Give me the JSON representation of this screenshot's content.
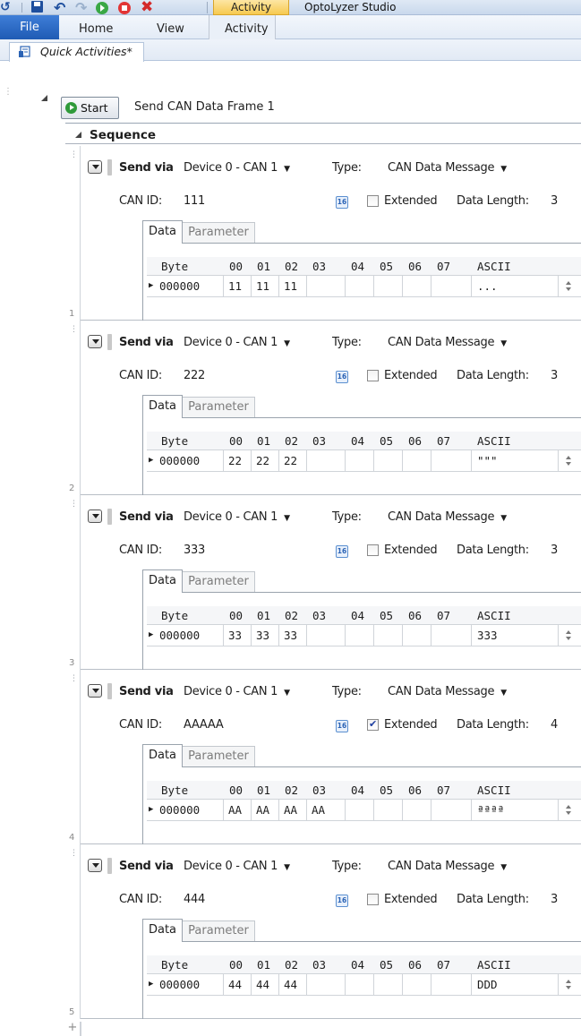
{
  "titlebar": {
    "context_tab": "Activity",
    "app_title": "OptoLyzer Studio",
    "colors": {
      "play": "#3aa845",
      "stop": "#e23535",
      "close": "#d32a2a",
      "save": "#1e4f9e"
    }
  },
  "ribbon": {
    "file": "File",
    "tabs": [
      "Home",
      "View",
      "Activity"
    ]
  },
  "document_tab": {
    "label": "Quick Activities*"
  },
  "activity": {
    "start_label": "Start",
    "name": "Send CAN Data Frame 1",
    "sequence_label": "Sequence"
  },
  "frame_labels": {
    "send_via": "Send via",
    "type": "Type:",
    "can_id": "CAN ID:",
    "extended": "Extended",
    "data_length": "Data Length:",
    "hex_icon": "16",
    "tab_data": "Data",
    "tab_parameter": "Parameter",
    "columns": [
      "Byte",
      "00",
      "01",
      "02",
      "03",
      "04",
      "05",
      "06",
      "07",
      "ASCII"
    ]
  },
  "frames": [
    {
      "number": "1",
      "device": "Device 0 - CAN 1",
      "type": "CAN Data Message",
      "can_id": "111",
      "extended": false,
      "data_length": "3",
      "row": {
        "byte": "000000",
        "values": [
          "11",
          "11",
          "11",
          "",
          "",
          "",
          "",
          ""
        ],
        "ascii": "..."
      }
    },
    {
      "number": "2",
      "device": "Device 0 - CAN 1",
      "type": "CAN Data Message",
      "can_id": "222",
      "extended": false,
      "data_length": "3",
      "row": {
        "byte": "000000",
        "values": [
          "22",
          "22",
          "22",
          "",
          "",
          "",
          "",
          ""
        ],
        "ascii": "\"\"\""
      }
    },
    {
      "number": "3",
      "device": "Device 0 - CAN 1",
      "type": "CAN Data Message",
      "can_id": "333",
      "extended": false,
      "data_length": "3",
      "row": {
        "byte": "000000",
        "values": [
          "33",
          "33",
          "33",
          "",
          "",
          "",
          "",
          ""
        ],
        "ascii": "333"
      }
    },
    {
      "number": "4",
      "device": "Device 0 - CAN 1",
      "type": "CAN Data Message",
      "can_id": "AAAAA",
      "extended": true,
      "data_length": "4",
      "row": {
        "byte": "000000",
        "values": [
          "AA",
          "AA",
          "AA",
          "AA",
          "",
          "",
          "",
          ""
        ],
        "ascii": "ªªªª"
      }
    },
    {
      "number": "5",
      "device": "Device 0 - CAN 1",
      "type": "CAN Data Message",
      "can_id": "444",
      "extended": false,
      "data_length": "3",
      "row": {
        "byte": "000000",
        "values": [
          "44",
          "44",
          "44",
          "",
          "",
          "",
          "",
          ""
        ],
        "ascii": "DDD"
      }
    }
  ],
  "add_row_symbol": "+"
}
